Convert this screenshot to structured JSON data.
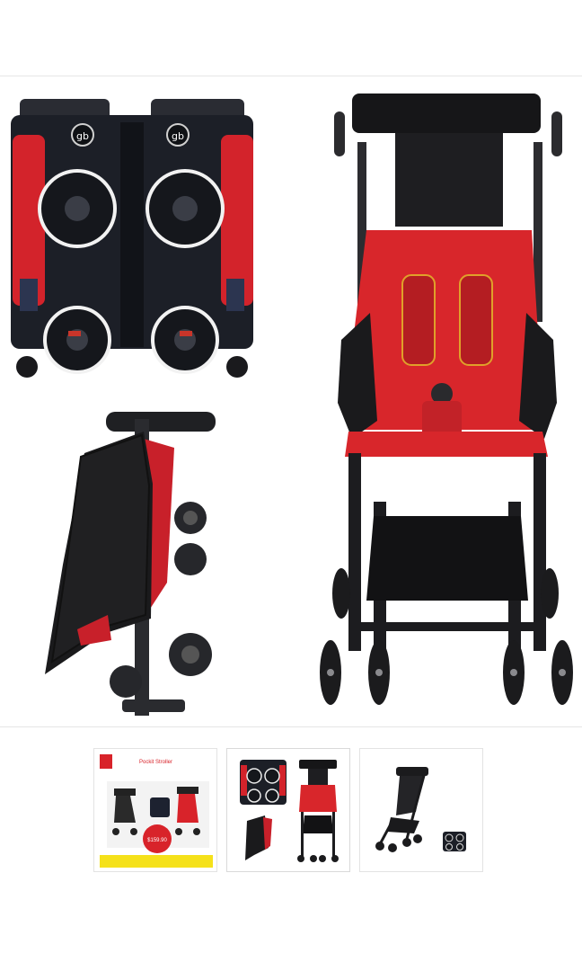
{
  "gallery": {
    "main_image": {
      "icon": "stroller-product-photo",
      "brand_mark": "gb"
    },
    "thumbnails": [
      {
        "icon": "stroller-promo-thumbnail",
        "promo_title": "Pockit Stroller",
        "price": "$159.90",
        "banner": "",
        "colors": {
          "accent": "#d8232a",
          "banner": "#f5e11a"
        }
      },
      {
        "icon": "stroller-folded-views-thumbnail"
      },
      {
        "icon": "stroller-black-thumbnail"
      }
    ]
  },
  "colors": {
    "stroller_red": "#d8262b",
    "frame_black": "#1b1b1d",
    "border": "#e3e3e3"
  }
}
